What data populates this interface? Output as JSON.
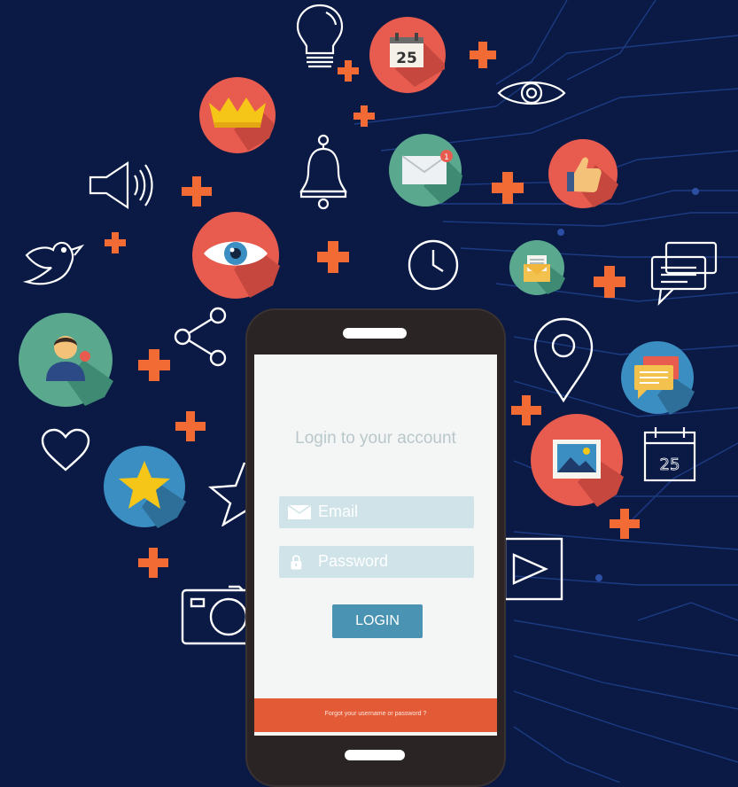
{
  "login": {
    "title": "Login to your account",
    "email_placeholder": "Email",
    "password_placeholder": "Password",
    "login_label": "LOGIN",
    "forgot_text": "Forgot your username or password ?"
  },
  "calendar_day": "25",
  "calendar_outline_day": "25",
  "mail_badge": "1",
  "colors": {
    "background": "#0a1a45",
    "accent_orange": "#f26b35",
    "coral": "#e85c4f",
    "teal": "#5aa98f",
    "blue": "#4a93b2",
    "line": "#2d4fa3"
  },
  "icons": [
    "lightbulb-icon",
    "calendar-icon",
    "eye-outline-icon",
    "crown-icon",
    "bell-icon",
    "mail-icon",
    "thumbs-up-icon",
    "megaphone-icon",
    "bird-icon",
    "eye-icon",
    "clock-icon",
    "envelope-open-icon",
    "chat-bubbles-icon",
    "user-icon",
    "share-icon",
    "location-pin-icon",
    "message-icon",
    "heart-icon",
    "star-icon",
    "star-outline-icon",
    "image-icon",
    "calendar-outline-icon",
    "play-icon",
    "camera-icon"
  ]
}
